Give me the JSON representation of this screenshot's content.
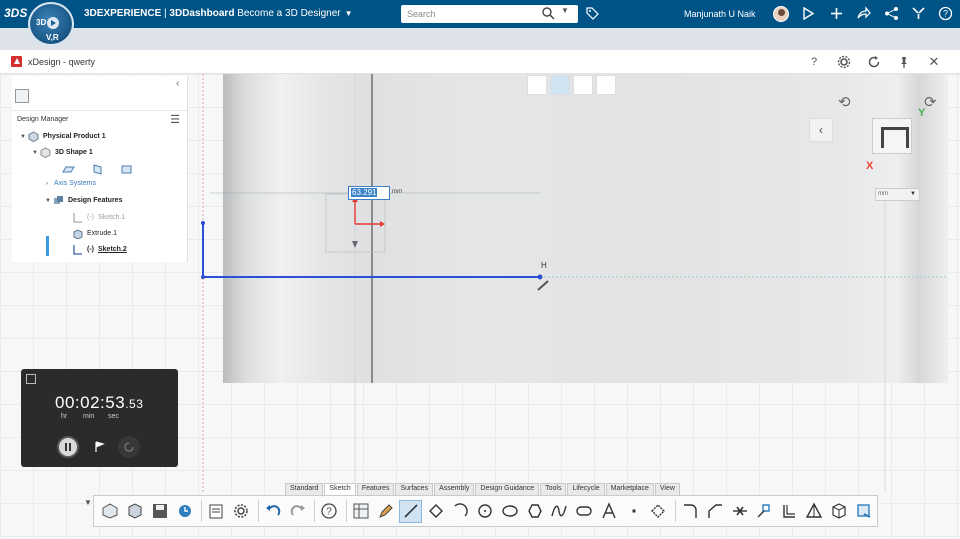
{
  "topbar": {
    "logo": "3DS",
    "brand_bold": "3DEXPERIENCE",
    "brand_sep": " | ",
    "brand_app": "3DDashboard",
    "brand_dashboard": " Become a 3D Designer",
    "search_placeholder": "Search",
    "user_name": "Manjunath U Naik",
    "compass_v": "V,R",
    "compass_3d": "3D"
  },
  "window": {
    "title": "xDesign - qwerty"
  },
  "design_manager": {
    "title": "Design Manager",
    "tree": {
      "physical_product": "Physical Product 1",
      "shape": "3D Shape 1",
      "axis_systems": "Axis Systems",
      "design_features": "Design Features",
      "sketch1": "Sketch.1",
      "extrude1": "Extrude.1",
      "sketch2": "Sketch.2",
      "sketch2_prefix": "(-)",
      "sketch1_prefix": "(-)"
    }
  },
  "timer": {
    "time": "00:02:53",
    "fraction": ".53",
    "hr": "hr",
    "min": "min",
    "sec": "sec"
  },
  "sketch": {
    "dimension_value": "63.291",
    "dimension_unit": "mm",
    "constraint_label": "H",
    "units": "mm",
    "axis_x": "X",
    "axis_y": "Y"
  },
  "action_bar": {
    "tabs": [
      "Standard",
      "Sketch",
      "Features",
      "Surfaces",
      "Assembly",
      "Design Guidance",
      "Tools",
      "Lifecycle",
      "Marketplace",
      "View"
    ],
    "active_tab": "Sketch"
  },
  "colors": {
    "topbar": "#005386",
    "sketch_line": "#2d4fd6",
    "accent": "#3c82c8"
  }
}
